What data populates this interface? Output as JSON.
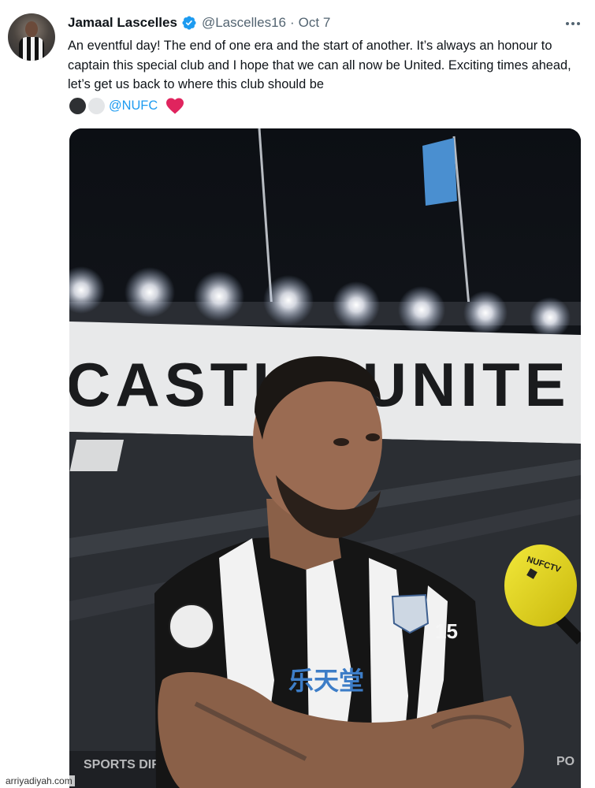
{
  "author": {
    "name": "Jamaal Lascelles",
    "handle": "@Lascelles16",
    "separator": "·",
    "date": "Oct 7"
  },
  "icons": {
    "verified": "verified-badge-icon",
    "more": "more-options-icon",
    "heart": "red-heart-icon",
    "black_circle": "black-circle-emoji",
    "white_circle": "white-circle-emoji"
  },
  "tweet": {
    "text": "An eventful day! The end of one era and the start of another. It’s always an honour to captain this special club and I hope that we can all now be United. Exciting times ahead, let’s get us back to where this club should be",
    "mention": "@NUFC"
  },
  "media": {
    "banner_text": "CASTLE UNITE",
    "sponsor_text": "乐天堂",
    "sleeve_number": "15",
    "mic_text": "NUFCTV",
    "board_left": "SPORTS DIR",
    "board_right": "PO"
  },
  "watermark": "arriyadiyah.com",
  "colors": {
    "link": "#1d9bf0",
    "verified": "#1d9bf0",
    "heart": "#e0245e",
    "text": "#0f1419",
    "muted": "#536471"
  }
}
